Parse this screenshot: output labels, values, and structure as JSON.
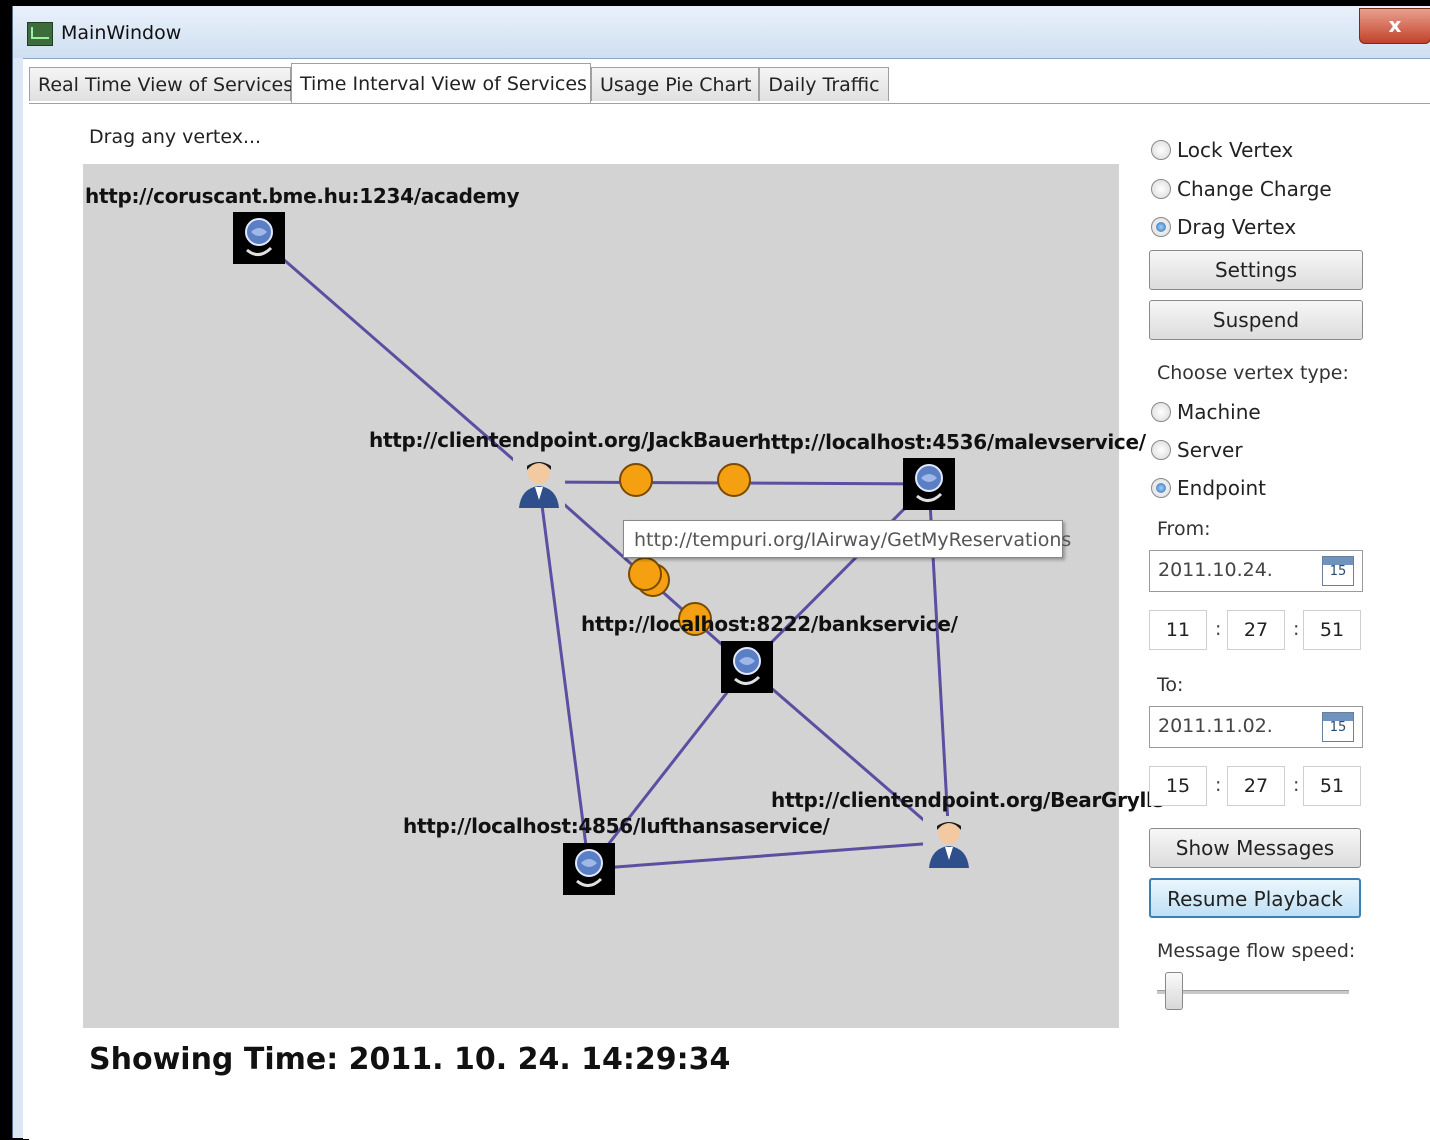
{
  "window": {
    "title": "MainWindow",
    "close_label": "x"
  },
  "tabs": [
    {
      "label": "Real Time View of Services"
    },
    {
      "label": "Time Interval View of Services"
    },
    {
      "label": "Usage Pie Chart"
    },
    {
      "label": "Daily Traffic"
    }
  ],
  "graph": {
    "hint": "Drag any vertex...",
    "vertices": [
      {
        "label": "http://coruscant.bme.hu:1234/academy",
        "kind": "service",
        "icon": "service-globe-icon"
      },
      {
        "label": "http://clientendpoint.org/JackBauer",
        "kind": "endpoint",
        "icon": "user-icon"
      },
      {
        "label": "http://localhost:4536/malevservice/",
        "kind": "service",
        "icon": "service-globe-icon"
      },
      {
        "label": "http://localhost:8222/bankservice/",
        "kind": "service",
        "icon": "service-globe-icon"
      },
      {
        "label": "http://localhost:4856/lufthansaservice/",
        "kind": "service",
        "icon": "service-globe-icon"
      },
      {
        "label": "http://clientendpoint.org/BearGrylls",
        "kind": "endpoint",
        "icon": "user-icon"
      }
    ],
    "tooltip": "http://tempuri.org/IAirway/GetMyReservations",
    "edge_color": "#5a4fa0",
    "message_color": "#f5a011"
  },
  "status": {
    "showing_time": "Showing Time: 2011. 10. 24. 14:29:34"
  },
  "controls": {
    "mode_options": [
      {
        "label": "Lock Vertex",
        "checked": false
      },
      {
        "label": "Change Charge",
        "checked": false
      },
      {
        "label": "Drag Vertex",
        "checked": true
      }
    ],
    "settings_label": "Settings",
    "suspend_label": "Suspend",
    "vertex_type_label": "Choose vertex type:",
    "vertex_types": [
      {
        "label": "Machine",
        "checked": false
      },
      {
        "label": "Server",
        "checked": false
      },
      {
        "label": "Endpoint",
        "checked": true
      }
    ],
    "from_label": "From:",
    "from_date": "2011.10.24.",
    "from_time": {
      "h": "11",
      "m": "27",
      "s": "51"
    },
    "to_label": "To:",
    "to_date": "2011.11.02.",
    "to_time": {
      "h": "15",
      "m": "27",
      "s": "51"
    },
    "calendar_day": "15",
    "time_separator": ":",
    "show_messages_label": "Show Messages",
    "resume_playback_label": "Resume Playback",
    "speed_label": "Message flow speed:",
    "speed_value": 0.05
  }
}
